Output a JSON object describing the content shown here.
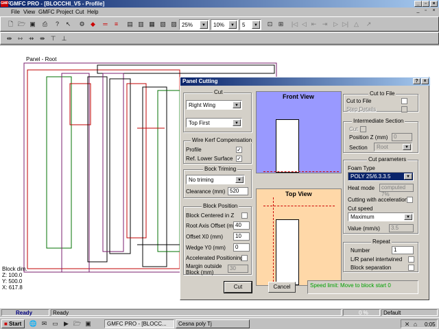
{
  "window": {
    "app_icon": "GMFC",
    "title": "GMFC PRO - [BLOCCHI_V5 - Profile]"
  },
  "menu": [
    "File",
    "View",
    "GMFC",
    "Project",
    "Cut",
    "Help"
  ],
  "toolbar": {
    "combo1": "25%",
    "combo2": "10%",
    "combo3": "5"
  },
  "canvas": {
    "panel_label": "Panel - Root",
    "block_dim_title": "Block dim.",
    "block_z": "Z: 100.0",
    "block_y": "Y: 500.0",
    "block_x": "X: 617.8"
  },
  "dialog": {
    "title": "Panel Cutting",
    "cut": {
      "title": "Cut",
      "wing": "Right Wing",
      "order": "Top First"
    },
    "kerf": {
      "title": "Wire Kerf Compensation",
      "profile": "Profile",
      "ref_lower": "Ref. Lower Surface"
    },
    "trim": {
      "title": "Bock Triming",
      "mode": "No triming",
      "clearance_label": "Clearance (mm)",
      "clearance_value": "520"
    },
    "position": {
      "title": "Block Position",
      "centered": "Block Centered in Z",
      "root_offset_label": "Root Axis Offset (mm)",
      "root_offset_value": "40",
      "offset_x0_label": "Offset X0 (mm)",
      "offset_x0_value": "10",
      "wedge_y0_label": "Wedge Y0 (mm)",
      "wedge_y0_value": "0",
      "accel": "Accelerated Positioning",
      "margin_label": "Margin outside Block (mm)",
      "margin_value": "30"
    },
    "front_view": "Front View",
    "top_view": "Top View",
    "cut_to_file": {
      "title": "Cut to File",
      "cut_label": "Cut to File",
      "step_label": "Step Details"
    },
    "inter": {
      "title": "Intermediate Section",
      "cut_label": "Cut",
      "pos_label": "Position Z (mm)",
      "pos_value": "0",
      "section_label": "Section",
      "section_value": "Root"
    },
    "params": {
      "title": "Cut parameters",
      "foam_label": "Foam Type",
      "foam_value": "POLY 25/6.3.3.5",
      "heat_label": "Heat mode",
      "heat_value": "computed 7%",
      "accel_label": "Cutting with acceleration",
      "speed_label": "Cut speed",
      "speed_value": "Maximum",
      "value_label": "Value (mm/s)",
      "value_value": "3.5"
    },
    "repeat": {
      "title": "Repeat",
      "number_label": "Number",
      "number_value": "1",
      "lr_label": "L/R panel intertwined",
      "sep_label": "Block separation"
    },
    "cut_button": "Cut",
    "cancel_button": "Cancel",
    "status_msg": "Speed limit: Move to block start 0"
  },
  "status": {
    "left": "Ready",
    "mid": "Ready",
    "pct": "0 %",
    "right": "Default"
  },
  "taskbar": {
    "start": "Start",
    "task1": "GMFC PRO - [BLOCC...",
    "task2": "Cesna poly Tj",
    "clock": "0:05"
  },
  "colors": {
    "front_bg": "#9999ff",
    "top_bg": "#ffd8a8",
    "status_green": "#00a000",
    "ready_blue": "#000080"
  }
}
